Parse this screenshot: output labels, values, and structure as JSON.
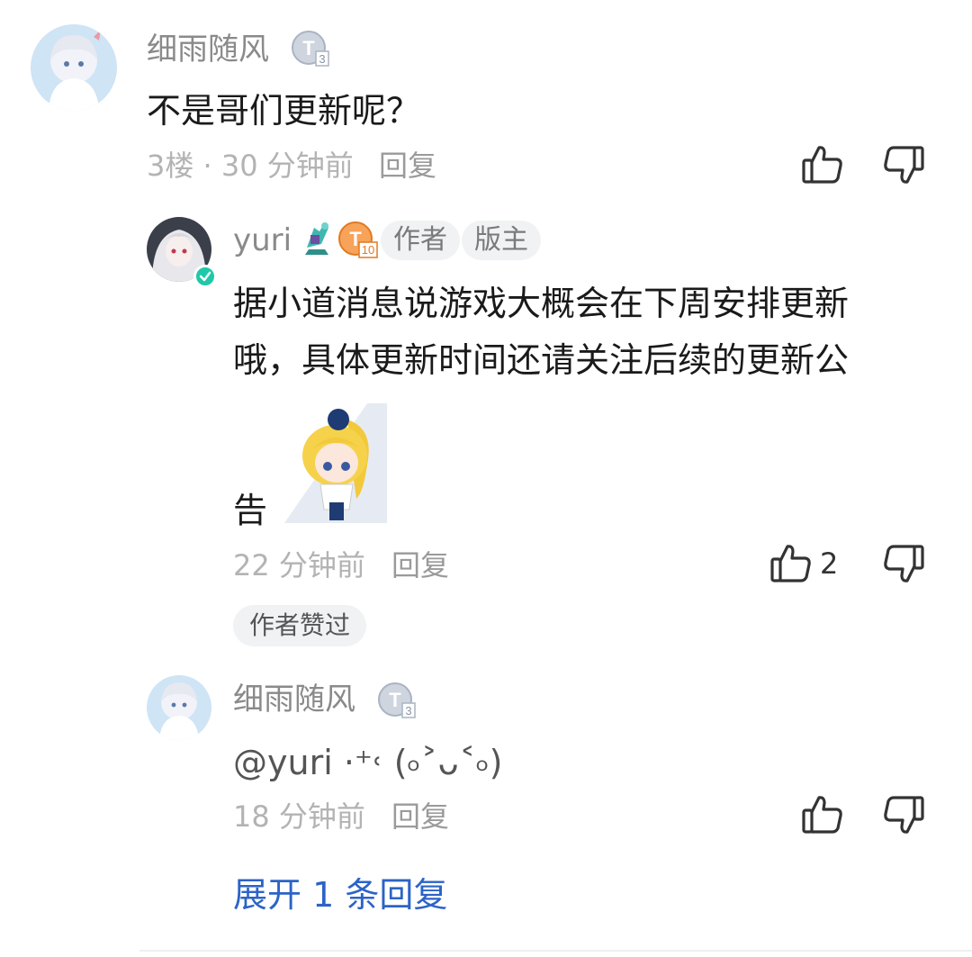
{
  "comment": {
    "username": "细雨随风",
    "text": "不是哥们更新呢？",
    "floor_time": "3楼 · 30 分钟前",
    "reply_label": "回复"
  },
  "author_reply": {
    "username": "yuri",
    "tag_author": "作者",
    "tag_moderator": "版主",
    "line1": "据小道消息说游戏大概会在下周安排更新",
    "line2": "哦，具体更新时间还请关注后续的更新公",
    "line3": "告",
    "time": "22 分钟前",
    "reply_label": "回复",
    "like_count": "2",
    "author_liked": "作者赞过"
  },
  "sub_reply": {
    "username": "细雨随风",
    "text": "@yuri ·⁺˓ (৹˃ᴗ˂৹)",
    "time": "18 分钟前",
    "reply_label": "回复"
  },
  "expand_label": "展开 1 条回复",
  "colors": {
    "accent": "#2c63c7",
    "verified": "#1fc8a8",
    "level_gold": "#f08c2b",
    "level_silver": "#aab3c2"
  }
}
